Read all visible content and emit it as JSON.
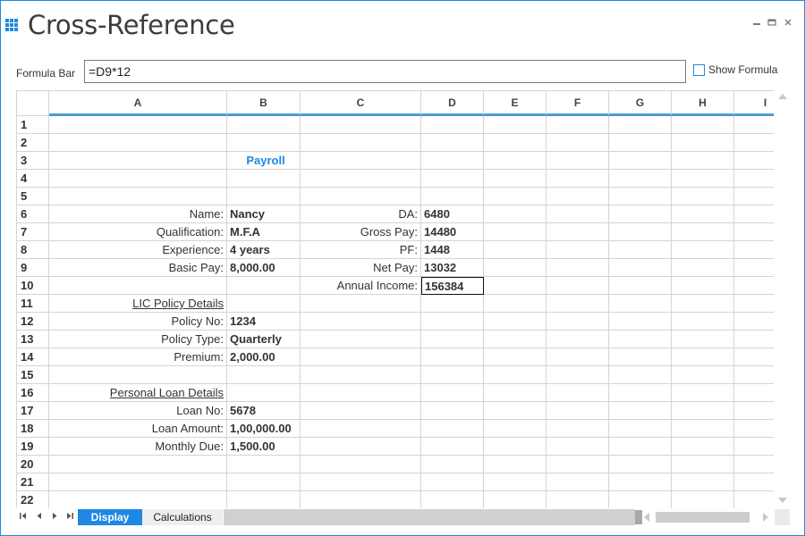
{
  "window": {
    "title": "Cross-Reference",
    "minimize": "▬",
    "maximize": "☐",
    "close": "✕"
  },
  "formula_bar": {
    "label": "Formula Bar",
    "value": "=D9*12",
    "show_formula_label": "Show Formula"
  },
  "columns": [
    "A",
    "B",
    "C",
    "D",
    "E",
    "F",
    "G",
    "H",
    "I"
  ],
  "rows": [
    "1",
    "2",
    "3",
    "4",
    "5",
    "6",
    "7",
    "8",
    "9",
    "10",
    "11",
    "12",
    "13",
    "14",
    "15",
    "16",
    "17",
    "18",
    "19",
    "20",
    "21",
    "22"
  ],
  "cells": {
    "B3": "Payroll",
    "A6": "Name:",
    "B6": "Nancy",
    "C6": "DA:",
    "D6": "6480",
    "A7": "Qualification:",
    "B7": "M.F.A",
    "C7": "Gross Pay:",
    "D7": "14480",
    "A8": "Experience:",
    "B8": "4 years",
    "C8": "PF:",
    "D8": "1448",
    "A9": "Basic Pay:",
    "B9": "8,000.00",
    "C9": "Net Pay:",
    "D9": "13032",
    "C10": "Annual Income:",
    "D10": "156384",
    "A11": "LIC Policy Details",
    "A12": "Policy No:",
    "B12": "1234",
    "A13": "Policy Type:",
    "B13": "Quarterly",
    "A14": "Premium:",
    "B14": "2,000.00",
    "A16": "Personal Loan Details",
    "A17": "Loan No:",
    "B17": "5678",
    "A18": "Loan Amount:",
    "B18": "1,00,000.00",
    "A19": "Monthly Due:",
    "B19": "1,500.00"
  },
  "selected_cell": "D10",
  "sheet_tabs": {
    "active": "Display",
    "other": "Calculations"
  },
  "nav": {
    "first": "⏮",
    "prev": "◀",
    "next": "▶",
    "last": "⏭"
  },
  "colors": {
    "accent": "#1e88e5",
    "header_underline": "#4a9bd4"
  }
}
